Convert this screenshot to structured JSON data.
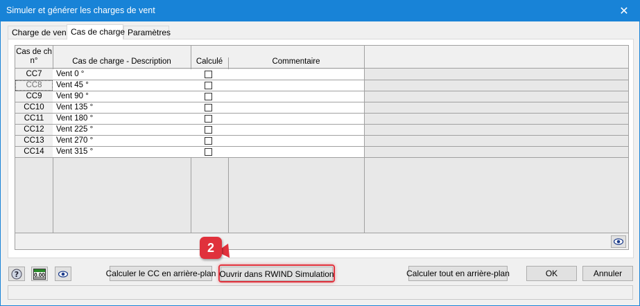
{
  "window": {
    "title": "Simuler et générer les charges de vent",
    "close_glyph": "✕"
  },
  "tabs": [
    {
      "label": "Charge de vent",
      "active": false
    },
    {
      "label": "Cas de charge",
      "active": true
    },
    {
      "label": "Paramètres",
      "active": false
    }
  ],
  "table": {
    "headers": {
      "id": "Cas de ch\nn°",
      "description": "Cas de charge - Description",
      "computed": "Calculé",
      "comment": "Commentaire"
    },
    "rows": [
      {
        "id": "CC7",
        "description": "Vent 0 °",
        "computed": false,
        "comment": "",
        "selected": false
      },
      {
        "id": "CC8",
        "description": "Vent 45 °",
        "computed": false,
        "comment": "",
        "selected": true
      },
      {
        "id": "CC9",
        "description": "Vent 90 °",
        "computed": false,
        "comment": "",
        "selected": false
      },
      {
        "id": "CC10",
        "description": "Vent 135 °",
        "computed": false,
        "comment": "",
        "selected": false
      },
      {
        "id": "CC11",
        "description": "Vent 180 °",
        "computed": false,
        "comment": "",
        "selected": false
      },
      {
        "id": "CC12",
        "description": "Vent 225 °",
        "computed": false,
        "comment": "",
        "selected": false
      },
      {
        "id": "CC13",
        "description": "Vent 270 °",
        "computed": false,
        "comment": "",
        "selected": false
      },
      {
        "id": "CC14",
        "description": "Vent 315 °",
        "computed": false,
        "comment": "",
        "selected": false
      }
    ]
  },
  "buttons": {
    "calc_lc_background": "Calculer le CC en arrière-plan",
    "open_rwind": "Ouvrir dans RWIND Simulation",
    "calc_all_background": "Calculer tout en arrière-plan",
    "ok": "OK",
    "cancel": "Annuler"
  },
  "icons": {
    "help": "help-icon",
    "units": "units-icon",
    "units_text": "0.00",
    "view": "eye-icon"
  },
  "callout": {
    "number": "2"
  },
  "colors": {
    "titlebar": "#1883d7",
    "callout": "#e0313c"
  }
}
